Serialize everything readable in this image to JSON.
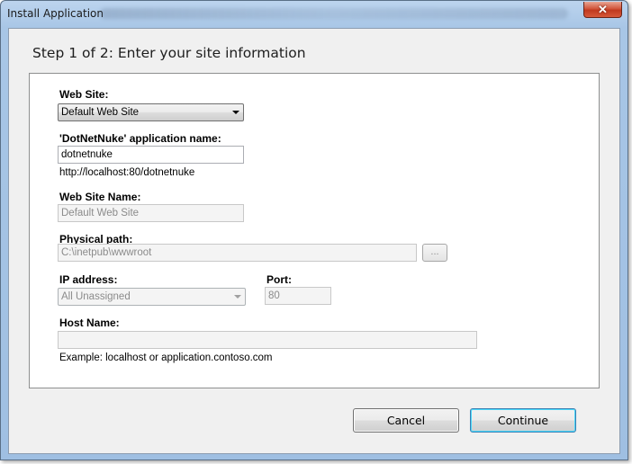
{
  "window": {
    "title": "Install Application",
    "close_glyph": "✕"
  },
  "step": {
    "heading": "Step 1 of 2: Enter your site information"
  },
  "form": {
    "web_site": {
      "label": "Web Site:",
      "value": "Default Web Site"
    },
    "app_name": {
      "label": "'DotNetNuke' application name:",
      "value": "dotnetnuke"
    },
    "url_preview": "http://localhost:80/dotnetnuke",
    "site_name": {
      "label": "Web Site Name:",
      "value": "Default Web Site"
    },
    "physical_path": {
      "label": "Physical path:",
      "value": "C:\\inetpub\\wwwroot",
      "browse_label": "..."
    },
    "ip_address": {
      "label": "IP address:",
      "value": "All Unassigned"
    },
    "port": {
      "label": "Port:",
      "value": "80"
    },
    "host_name": {
      "label": "Host Name:",
      "value": "",
      "example": "Example: localhost or application.contoso.com"
    }
  },
  "buttons": {
    "cancel": "Cancel",
    "continue": "Continue"
  },
  "icons": {
    "close": "close-icon",
    "dropdown": "chevron-down-icon"
  }
}
